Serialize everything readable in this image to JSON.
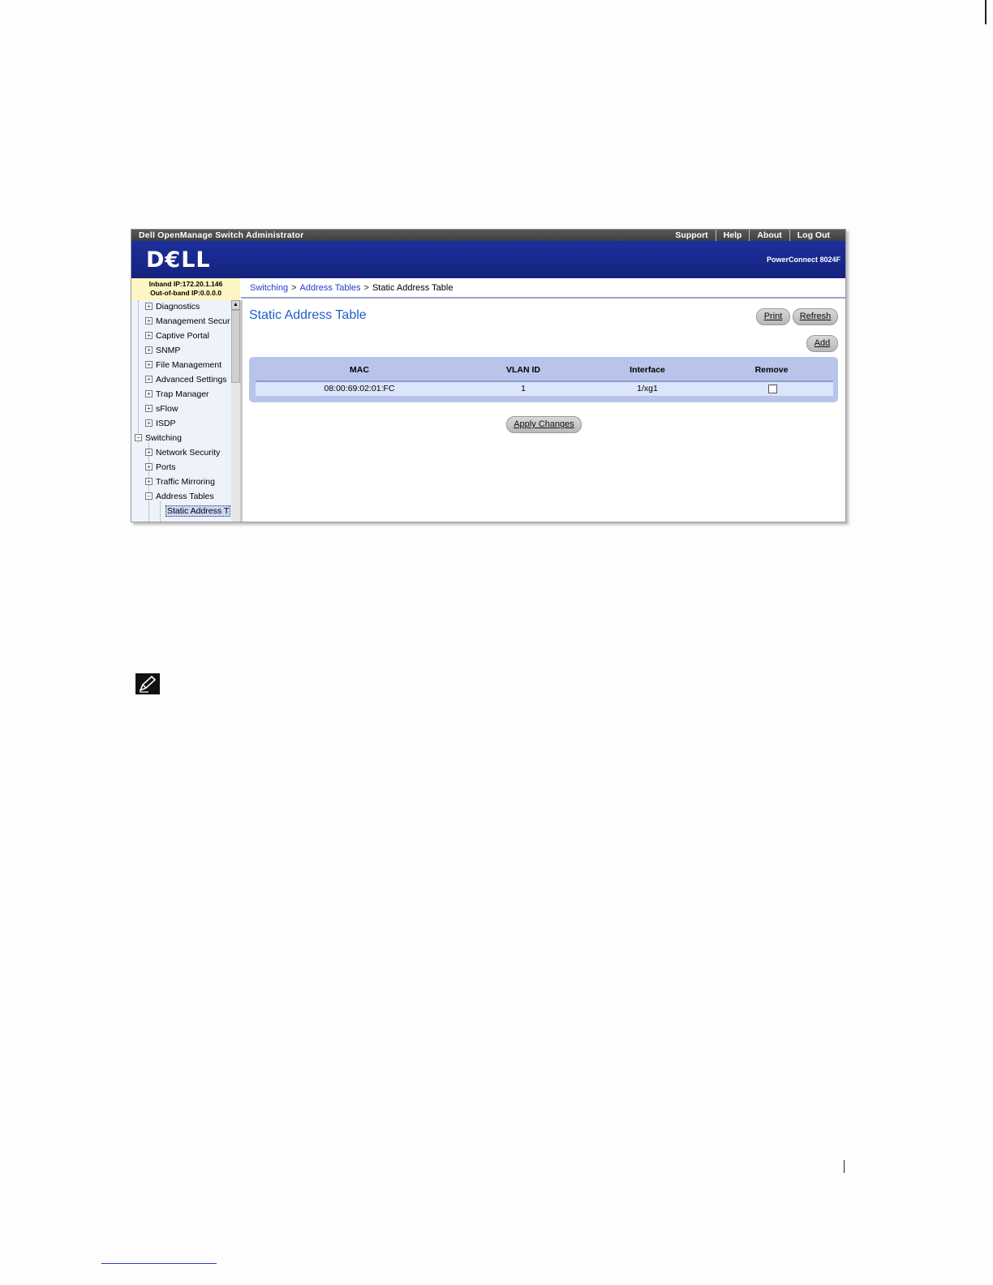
{
  "window": {
    "app_title": "Dell OpenManage Switch Administrator",
    "top_links": [
      "Support",
      "Help",
      "About",
      "Log Out"
    ],
    "brand_logo": "D€LL",
    "model": "PowerConnect 8024F"
  },
  "ip_info": {
    "inband": "Inband IP:172.20.1.146",
    "out_of_band": "Out-of-band IP:0.0.0.0"
  },
  "breadcrumb": {
    "items": [
      "Switching",
      "Address Tables"
    ],
    "separator": ">",
    "current": "Static Address Table"
  },
  "sidebar": {
    "items": [
      {
        "label": "Diagnostics",
        "state": "collapsed"
      },
      {
        "label": "Management Securi",
        "state": "collapsed"
      },
      {
        "label": "Captive Portal",
        "state": "collapsed"
      },
      {
        "label": "SNMP",
        "state": "collapsed"
      },
      {
        "label": "File Management",
        "state": "collapsed"
      },
      {
        "label": "Advanced Settings",
        "state": "collapsed"
      },
      {
        "label": "Trap Manager",
        "state": "collapsed"
      },
      {
        "label": "sFlow",
        "state": "collapsed"
      },
      {
        "label": "ISDP",
        "state": "collapsed"
      },
      {
        "label": "Switching",
        "state": "expanded"
      },
      {
        "label": "Network Security",
        "state": "collapsed"
      },
      {
        "label": "Ports",
        "state": "collapsed"
      },
      {
        "label": "Traffic Mirroring",
        "state": "collapsed"
      },
      {
        "label": "Address Tables",
        "state": "expanded"
      },
      {
        "label": "Static Address T",
        "state": "selected"
      }
    ]
  },
  "main": {
    "title": "Static Address Table",
    "buttons": {
      "print": "Print",
      "refresh": "Refresh",
      "add": "Add",
      "apply": "Apply Changes"
    },
    "table": {
      "columns": [
        "MAC",
        "VLAN ID",
        "Interface",
        "Remove"
      ],
      "rows": [
        {
          "mac": "08:00:69:02:01:FC",
          "vlan": "1",
          "interface": "1/xg1",
          "remove": false
        }
      ]
    }
  },
  "colors": {
    "banner": "#1d2f9c",
    "title_blue": "#1f5ec8",
    "table_bg": "#b8c4ea",
    "ip_bg": "#fdf6c3"
  }
}
